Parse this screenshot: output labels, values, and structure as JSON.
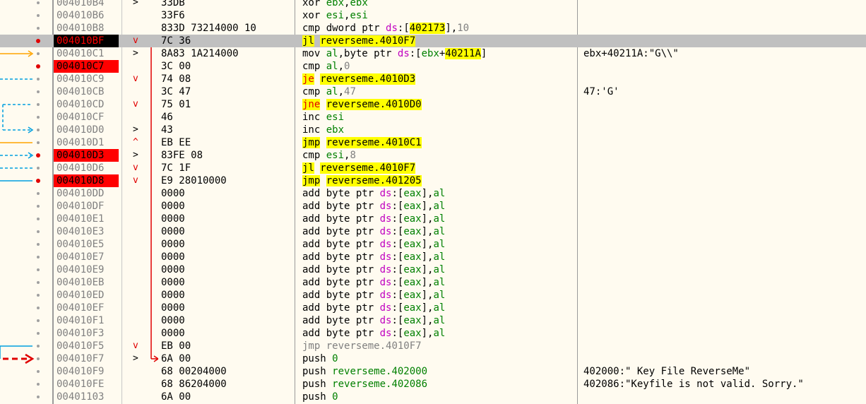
{
  "rows": [
    {
      "addr": "004010B4",
      "bytes": "33DB",
      "mn": "xor",
      "ops": "ebx,ebx",
      "comment": "",
      "state": "normal",
      "mark": ">",
      "markColor": "black"
    },
    {
      "addr": "004010B6",
      "bytes": "33F6",
      "mn": "xor",
      "ops": "esi,esi",
      "comment": "",
      "state": "normal",
      "mark": "",
      "markColor": ""
    },
    {
      "addr": "004010B8",
      "bytes": "833D 73214000 10",
      "mn": "cmp",
      "ops": "dword ptr ds:[402173],10",
      "comment": "",
      "state": "normal",
      "mark": "",
      "markColor": ""
    },
    {
      "addr": "004010BF",
      "bytes": "7C 36",
      "mn": "jl",
      "ops": "reverseme.4010F7",
      "comment": "",
      "state": "current",
      "mark": "v",
      "markColor": "red"
    },
    {
      "addr": "004010C1",
      "bytes": "8A83 1A214000",
      "mn": "mov",
      "ops": "al,byte ptr ds:[ebx+40211A]",
      "comment": "ebx+40211A:\"G\\\\\"",
      "state": "normal",
      "mark": ">",
      "markColor": "black"
    },
    {
      "addr": "004010C7",
      "bytes": "3C 00",
      "mn": "cmp",
      "ops": "al,0",
      "comment": "",
      "state": "bp",
      "mark": "",
      "markColor": ""
    },
    {
      "addr": "004010C9",
      "bytes": "74 08",
      "mn": "je",
      "ops": "reverseme.4010D3",
      "comment": "",
      "state": "normal",
      "mark": "v",
      "markColor": "red"
    },
    {
      "addr": "004010CB",
      "bytes": "3C 47",
      "mn": "cmp",
      "ops": "al,47",
      "comment": "47:'G'",
      "state": "normal",
      "mark": "",
      "markColor": ""
    },
    {
      "addr": "004010CD",
      "bytes": "75 01",
      "mn": "jne",
      "ops": "reverseme.4010D0",
      "comment": "",
      "state": "normal",
      "mark": "v",
      "markColor": "red"
    },
    {
      "addr": "004010CF",
      "bytes": "46",
      "mn": "inc",
      "ops": "esi",
      "comment": "",
      "state": "normal",
      "mark": "",
      "markColor": ""
    },
    {
      "addr": "004010D0",
      "bytes": "43",
      "mn": "inc",
      "ops": "ebx",
      "comment": "",
      "state": "normal",
      "mark": ">",
      "markColor": "black"
    },
    {
      "addr": "004010D1",
      "bytes": "EB EE",
      "mn": "jmp",
      "ops": "reverseme.4010C1",
      "comment": "",
      "state": "normal",
      "mark": "^",
      "markColor": "red"
    },
    {
      "addr": "004010D3",
      "bytes": "83FE 08",
      "mn": "cmp",
      "ops": "esi,8",
      "comment": "",
      "state": "bp",
      "mark": ">",
      "markColor": "black"
    },
    {
      "addr": "004010D6",
      "bytes": "7C 1F",
      "mn": "jl",
      "ops": "reverseme.4010F7",
      "comment": "",
      "state": "normal",
      "mark": "v",
      "markColor": "red"
    },
    {
      "addr": "004010D8",
      "bytes": "E9 28010000",
      "mn": "jmp",
      "ops": "reverseme.401205",
      "comment": "",
      "state": "bp",
      "mark": "v",
      "markColor": "red"
    },
    {
      "addr": "004010DD",
      "bytes": "0000",
      "mn": "add",
      "ops": "byte ptr ds:[eax],al",
      "comment": "",
      "state": "normal",
      "mark": "",
      "markColor": ""
    },
    {
      "addr": "004010DF",
      "bytes": "0000",
      "mn": "add",
      "ops": "byte ptr ds:[eax],al",
      "comment": "",
      "state": "normal",
      "mark": "",
      "markColor": ""
    },
    {
      "addr": "004010E1",
      "bytes": "0000",
      "mn": "add",
      "ops": "byte ptr ds:[eax],al",
      "comment": "",
      "state": "normal",
      "mark": "",
      "markColor": ""
    },
    {
      "addr": "004010E3",
      "bytes": "0000",
      "mn": "add",
      "ops": "byte ptr ds:[eax],al",
      "comment": "",
      "state": "normal",
      "mark": "",
      "markColor": ""
    },
    {
      "addr": "004010E5",
      "bytes": "0000",
      "mn": "add",
      "ops": "byte ptr ds:[eax],al",
      "comment": "",
      "state": "normal",
      "mark": "",
      "markColor": ""
    },
    {
      "addr": "004010E7",
      "bytes": "0000",
      "mn": "add",
      "ops": "byte ptr ds:[eax],al",
      "comment": "",
      "state": "normal",
      "mark": "",
      "markColor": ""
    },
    {
      "addr": "004010E9",
      "bytes": "0000",
      "mn": "add",
      "ops": "byte ptr ds:[eax],al",
      "comment": "",
      "state": "normal",
      "mark": "",
      "markColor": ""
    },
    {
      "addr": "004010EB",
      "bytes": "0000",
      "mn": "add",
      "ops": "byte ptr ds:[eax],al",
      "comment": "",
      "state": "normal",
      "mark": "",
      "markColor": ""
    },
    {
      "addr": "004010ED",
      "bytes": "0000",
      "mn": "add",
      "ops": "byte ptr ds:[eax],al",
      "comment": "",
      "state": "normal",
      "mark": "",
      "markColor": ""
    },
    {
      "addr": "004010EF",
      "bytes": "0000",
      "mn": "add",
      "ops": "byte ptr ds:[eax],al",
      "comment": "",
      "state": "normal",
      "mark": "",
      "markColor": ""
    },
    {
      "addr": "004010F1",
      "bytes": "0000",
      "mn": "add",
      "ops": "byte ptr ds:[eax],al",
      "comment": "",
      "state": "normal",
      "mark": "",
      "markColor": ""
    },
    {
      "addr": "004010F3",
      "bytes": "0000",
      "mn": "add",
      "ops": "byte ptr ds:[eax],al",
      "comment": "",
      "state": "normal",
      "mark": "",
      "markColor": ""
    },
    {
      "addr": "004010F5",
      "bytes": "EB 00",
      "mn": "jmp",
      "ops": "reverseme.4010F7",
      "comment": "",
      "state": "normal",
      "mark": "v",
      "markColor": "red"
    },
    {
      "addr": "004010F7",
      "bytes": "6A 00",
      "mn": "push",
      "ops": "0",
      "comment": "",
      "state": "normal",
      "mark": ">",
      "markColor": "black"
    },
    {
      "addr": "004010F9",
      "bytes": "68 00204000",
      "mn": "push",
      "ops": "reverseme.402000",
      "comment": "402000:\" Key File ReverseMe\"",
      "state": "normal",
      "mark": "",
      "markColor": ""
    },
    {
      "addr": "004010FE",
      "bytes": "68 86204000",
      "mn": "push",
      "ops": "reverseme.402086",
      "comment": "402086:\"Keyfile is not valid. Sorry.\"",
      "state": "normal",
      "mark": "",
      "markColor": ""
    },
    {
      "addr": "00401103",
      "bytes": "6A 00",
      "mn": "push",
      "ops": "0",
      "comment": "",
      "state": "normal",
      "mark": "",
      "markColor": ""
    }
  ],
  "colors": {
    "background": "#fffbf0",
    "breakpoint": "#ff0000",
    "highlight": "#ffff00",
    "selected_row": "#c0c0c0",
    "arrow_orange": "#ffa500",
    "arrow_cyan": "#00a0e0",
    "arrow_red": "#e00000"
  }
}
